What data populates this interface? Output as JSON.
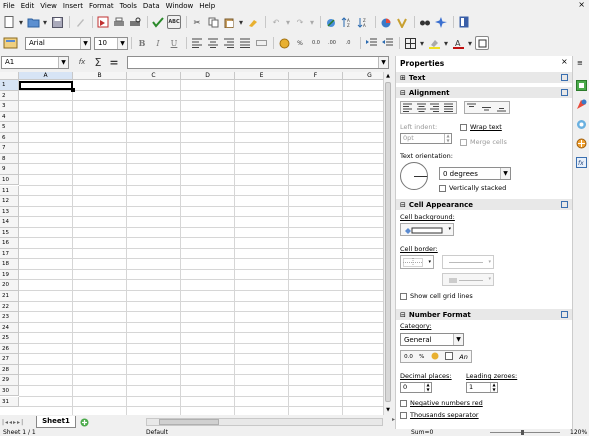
{
  "menu": [
    "File",
    "Edit",
    "View",
    "Insert",
    "Format",
    "Tools",
    "Data",
    "Window",
    "Help"
  ],
  "menu_close": "×",
  "font": {
    "name": "Arial",
    "size": "10"
  },
  "name_box": "A1",
  "formula_value": "",
  "columns": [
    "A",
    "B",
    "C",
    "D",
    "E",
    "F",
    "G"
  ],
  "rows": [
    "1",
    "2",
    "3",
    "4",
    "5",
    "6",
    "7",
    "8",
    "9",
    "10",
    "11",
    "12",
    "13",
    "14",
    "15",
    "16",
    "17",
    "18",
    "19",
    "20",
    "21",
    "22",
    "23",
    "24",
    "25",
    "26",
    "27",
    "28",
    "29",
    "30",
    "31"
  ],
  "sheet_tab": "Sheet1",
  "status": {
    "sheet": "Sheet 1 / 1",
    "style": "Default",
    "sum": "Sum=0",
    "zoom": "120%"
  },
  "sidebar": {
    "title": "Properties",
    "text_section": "Text",
    "alignment_section": "Alignment",
    "left_indent_label": "Left indent:",
    "left_indent_value": "0pt",
    "wrap_text": "Wrap text",
    "merge_cells": "Merge cells",
    "text_orientation_label": "Text orientation:",
    "orientation_value": "0 degrees",
    "vertically_stacked": "Vertically stacked",
    "cell_appearance_section": "Cell Appearance",
    "cell_background_label": "Cell background:",
    "cell_border_label": "Cell border:",
    "show_grid_lines": "Show cell grid lines",
    "number_format_section": "Number Format",
    "category_label": "Category:",
    "category_value": "General",
    "format_an": "An",
    "decimal_places_label": "Decimal places:",
    "decimal_places_value": "0",
    "leading_zeroes_label": "Leading zeroes:",
    "leading_zeroes_value": "1",
    "negative_red": "Negative numbers red",
    "thousands_sep": "Thousands separator"
  },
  "colors": {
    "accent": "#3a6fb0",
    "selected_cell_border": "#000000",
    "header_active": "#d7e4f5"
  }
}
